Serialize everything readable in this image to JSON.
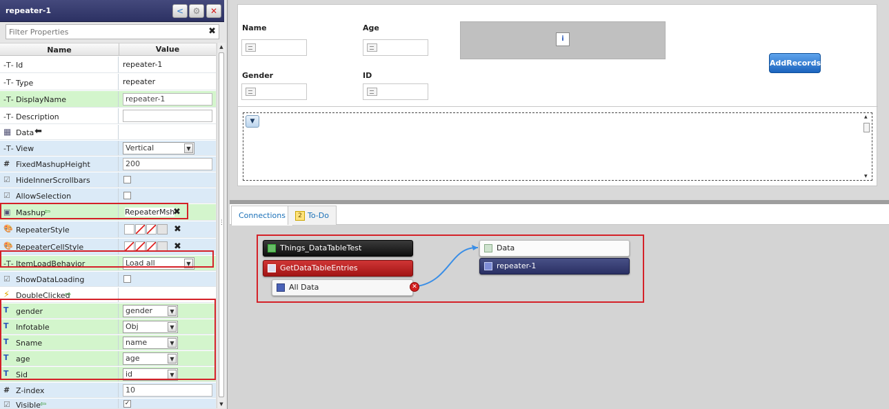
{
  "panel": {
    "title": "repeater-1",
    "filter_placeholder": "Filter Properties",
    "col_name": "Name",
    "col_value": "Value"
  },
  "props": {
    "id": {
      "label": "Id",
      "value": "repeater-1"
    },
    "type": {
      "label": "Type",
      "value": "repeater"
    },
    "displayname": {
      "label": "DisplayName",
      "value": "repeater-1"
    },
    "description": {
      "label": "Description",
      "value": ""
    },
    "data": {
      "label": "Data"
    },
    "view": {
      "label": "View",
      "value": "Vertical"
    },
    "fixedheight": {
      "label": "FixedMashupHeight",
      "value": "200"
    },
    "hidescroll": {
      "label": "HideInnerScrollbars"
    },
    "allowsel": {
      "label": "AllowSelection"
    },
    "mashup": {
      "label": "Mashup",
      "value": "RepeaterMsh"
    },
    "repstyle": {
      "label": "RepeaterStyle"
    },
    "repcellstyle": {
      "label": "RepeaterCellStyle"
    },
    "itemload": {
      "label": "ItemLoadBehavior",
      "value": "Load all"
    },
    "showloading": {
      "label": "ShowDataLoading"
    },
    "dblclick": {
      "label": "DoubleClicked"
    },
    "gender": {
      "label": "gender",
      "value": "gender"
    },
    "infotable": {
      "label": "Infotable",
      "value": "Obj"
    },
    "sname": {
      "label": "Sname",
      "value": "name"
    },
    "age": {
      "label": "age",
      "value": "age"
    },
    "sid": {
      "label": "Sid",
      "value": "id"
    },
    "zindex": {
      "label": "Z-index",
      "value": "10"
    },
    "visible": {
      "label": "Visible",
      "checked": "✓"
    }
  },
  "form": {
    "name_label": "Name",
    "age_label": "Age",
    "gender_label": "Gender",
    "id_label": "ID",
    "add_button": "AddRecords"
  },
  "tabs": {
    "connections": "Connections",
    "todo": "To-Do",
    "todo_count": "2"
  },
  "connections": {
    "thing": "Things_DataTableTest",
    "service": "GetDataTableEntries",
    "output": "All Data",
    "target_prop": "Data",
    "target_widget": "repeater-1"
  },
  "colors": {
    "highlight_border": "#d42027",
    "header_bg": "#2c3163",
    "row_green": "#d3f5cc",
    "row_blue": "#dbeaf7",
    "button_blue": "#1b64be"
  }
}
